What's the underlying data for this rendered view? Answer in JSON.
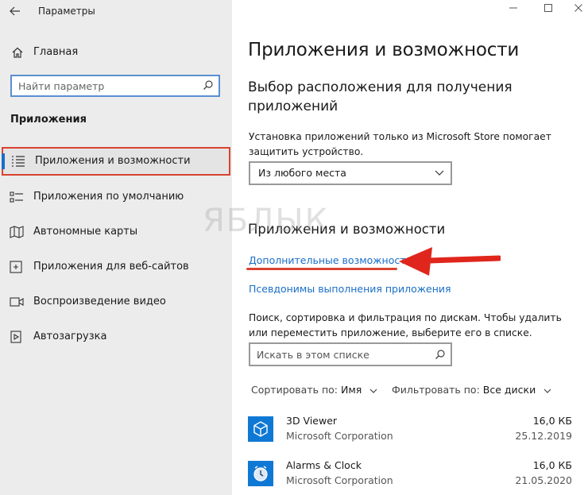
{
  "window": {
    "title": "Параметры",
    "back_label": "←"
  },
  "sidebar": {
    "home_label": "Главная",
    "search_placeholder": "Найти параметр",
    "section_label": "Приложения",
    "items": [
      {
        "label": "Приложения и возможности",
        "icon": "list-icon",
        "active": true
      },
      {
        "label": "Приложения по умолчанию",
        "icon": "default-apps-icon"
      },
      {
        "label": "Автономные карты",
        "icon": "map-icon"
      },
      {
        "label": "Приложения для веб-сайтов",
        "icon": "web-apps-icon"
      },
      {
        "label": "Воспроизведение видео",
        "icon": "video-icon"
      },
      {
        "label": "Автозагрузка",
        "icon": "startup-icon"
      }
    ]
  },
  "main": {
    "title": "Приложения и возможности",
    "install_heading": "Выбор расположения для получения приложений",
    "install_desc": "Установка приложений только из Microsoft Store помогает защитить устройство.",
    "install_dropdown_value": "Из любого места",
    "apps_heading": "Приложения и возможности",
    "link_optional_features": "Дополнительные возможности",
    "link_app_aliases": "Псевдонимы выполнения приложения",
    "list_desc": "Поиск, сортировка и фильтрация по дискам. Чтобы удалить или переместить приложение, выберите его в списке.",
    "list_search_placeholder": "Искать в этом списке",
    "sort_label": "Сортировать по:",
    "sort_value": "Имя",
    "filter_label": "Фильтровать по:",
    "filter_value": "Все диски",
    "apps": [
      {
        "name": "3D Viewer",
        "publisher": "Microsoft Corporation",
        "size": "16,0 КБ",
        "date": "25.12.2019"
      },
      {
        "name": "Alarms & Clock",
        "publisher": "Microsoft Corporation",
        "size": "16,0 КБ",
        "date": "21.05.2020"
      }
    ]
  },
  "watermark": "ЯБЛЫК",
  "colors": {
    "accent": "#1a6ec7",
    "highlight": "#d9432f",
    "sidebar_bg": "#ececec"
  }
}
